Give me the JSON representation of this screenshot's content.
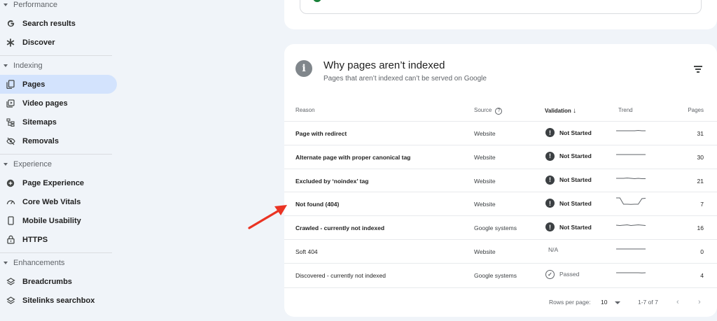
{
  "sidebar": {
    "sections": [
      {
        "label": "Performance",
        "items": [
          {
            "label": "Search results",
            "icon": "google-g-icon"
          },
          {
            "label": "Discover",
            "icon": "asterisk-icon"
          }
        ]
      },
      {
        "label": "Indexing",
        "items": [
          {
            "label": "Pages",
            "icon": "pages-icon",
            "active": true
          },
          {
            "label": "Video pages",
            "icon": "video-pages-icon"
          },
          {
            "label": "Sitemaps",
            "icon": "sitemap-icon"
          },
          {
            "label": "Removals",
            "icon": "eye-off-icon"
          }
        ]
      },
      {
        "label": "Experience",
        "items": [
          {
            "label": "Page Experience",
            "icon": "plus-circle-icon"
          },
          {
            "label": "Core Web Vitals",
            "icon": "gauge-icon"
          },
          {
            "label": "Mobile Usability",
            "icon": "phone-icon"
          },
          {
            "label": "HTTPS",
            "icon": "lock-icon"
          }
        ]
      },
      {
        "label": "Enhancements",
        "items": [
          {
            "label": "Breadcrumbs",
            "icon": "layers-icon"
          },
          {
            "label": "Sitelinks searchbox",
            "icon": "layers-icon"
          }
        ]
      }
    ]
  },
  "card": {
    "title": "Why pages aren’t indexed",
    "subtitle": "Pages that aren’t indexed can’t be served on Google",
    "columns": {
      "reason": "Reason",
      "source": "Source",
      "validation": "Validation",
      "trend": "Trend",
      "pages": "Pages"
    },
    "rows": [
      {
        "reason": "Page with redirect",
        "source": "Website",
        "validation": "Not Started",
        "status": "not-started",
        "pages": "31",
        "trend": [
          5,
          5,
          5,
          5,
          5,
          5,
          4.5,
          5,
          5
        ],
        "bold": true
      },
      {
        "reason": "Alternate page with proper canonical tag",
        "source": "Website",
        "validation": "Not Started",
        "status": "not-started",
        "pages": "30",
        "trend": [
          5,
          5,
          5,
          5,
          5,
          5,
          5,
          5,
          5
        ],
        "bold": true
      },
      {
        "reason": "Excluded by ‘noindex’ tag",
        "source": "Website",
        "validation": "Not Started",
        "status": "not-started",
        "pages": "21",
        "trend": [
          5,
          5,
          5,
          4.5,
          5,
          5.5,
          5,
          5.5,
          5.5
        ],
        "bold": true
      },
      {
        "reason": "Not found (404)",
        "source": "Website",
        "validation": "Not Started",
        "status": "not-started",
        "pages": "7",
        "trend": [
          0,
          0,
          9,
          9,
          9.3,
          9,
          9,
          1,
          0.5
        ],
        "bold": true
      },
      {
        "reason": "Crawled - currently not indexed",
        "source": "Google systems",
        "validation": "Not Started",
        "status": "not-started",
        "pages": "16",
        "trend": [
          5,
          5.5,
          5,
          4.5,
          5.5,
          5,
          4.5,
          5,
          5.5
        ],
        "bold": true
      },
      {
        "reason": "Soft 404",
        "source": "Website",
        "validation": "N/A",
        "status": "na",
        "pages": "0",
        "trend": [
          5,
          5,
          5,
          5,
          5,
          5,
          5,
          5,
          5
        ],
        "bold": false
      },
      {
        "reason": "Discovered - currently not indexed",
        "source": "Google systems",
        "validation": "Passed",
        "status": "passed",
        "pages": "4",
        "trend": [
          5,
          5,
          5,
          5,
          5,
          5,
          5,
          5.3,
          5
        ],
        "bold": false
      }
    ],
    "footer": {
      "rows_per_page_label": "Rows per page:",
      "rows_per_page_value": "10",
      "range": "1-7 of 7"
    }
  },
  "colors": {
    "accent": "#d3e3fd",
    "arrow": "#ea3323",
    "success": "#188038"
  }
}
